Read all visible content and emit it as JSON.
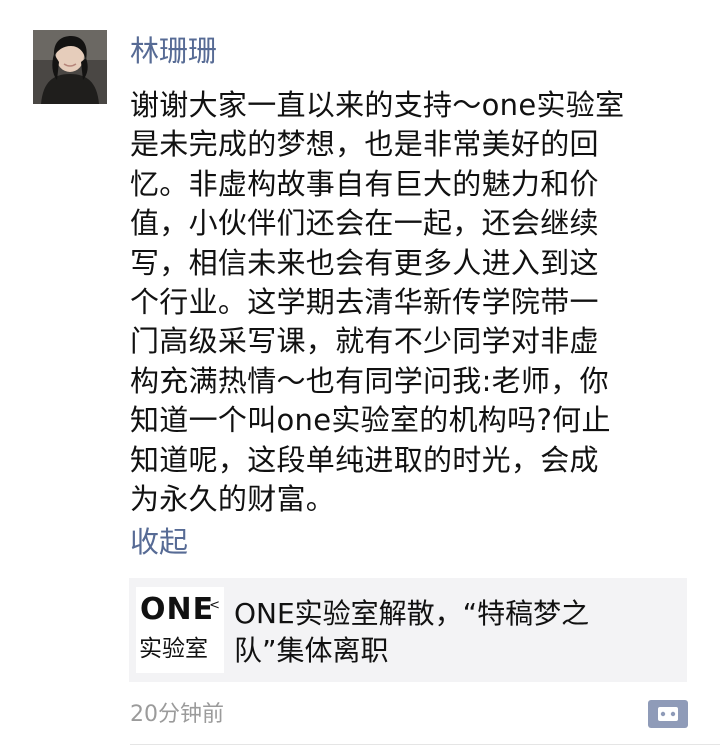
{
  "post": {
    "author": "林珊珊",
    "content": "谢谢大家一直以来的支持～one实验室\n是未完成的梦想，也是非常美好的回\n忆。非虚构故事自有巨大的魅力和价\n值，小伙伴们还会在一起，还会继续\n写，相信未来也会有更多人进入到这\n个行业。这学期去清华新传学院带一\n门高级采写课，就有不少同学对非虚\n构充满热情～也有同学问我:老师，你\n知道一个叫one实验室的机构吗?何止\n知道呢，这段单纯进取的时光，会成\n为永久的财富。",
    "collapse_label": "收起",
    "link": {
      "logo_top": "ONE",
      "logo_mark": "<",
      "logo_bottom": "实验室",
      "title": "ONE实验室解散，“特稿梦之\n队”集体离职"
    },
    "timestamp": "20分钟前"
  },
  "colors": {
    "name_link": "#576b95",
    "body_text": "#111111",
    "meta_text": "#9b9b9b",
    "card_bg": "#f3f3f5",
    "comment_button": "#8f9bb8"
  },
  "icons": {
    "avatar": "profile-photo",
    "comment": "comment-dots-icon"
  }
}
